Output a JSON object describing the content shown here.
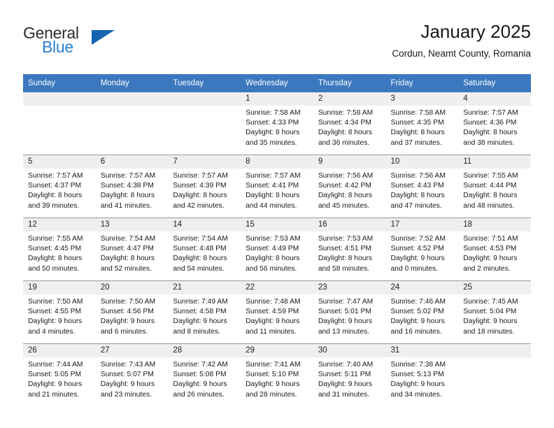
{
  "brand": {
    "line1": "General",
    "line2": "Blue",
    "accent_color": "#1565b0",
    "text_color": "#2a7fd4"
  },
  "header": {
    "title": "January 2025",
    "location": "Cordun, Neamt County, Romania"
  },
  "theme": {
    "header_bar": "#3b78bf",
    "daynum_bg": "#efefef",
    "grid_line": "#9a9a9a"
  },
  "weekdays": [
    {
      "label": "Sunday"
    },
    {
      "label": "Monday"
    },
    {
      "label": "Tuesday"
    },
    {
      "label": "Wednesday"
    },
    {
      "label": "Thursday"
    },
    {
      "label": "Friday"
    },
    {
      "label": "Saturday"
    }
  ],
  "weeks": [
    [
      {
        "day": "",
        "empty": true,
        "sunrise": "",
        "sunset": "",
        "daylight1": "",
        "daylight2": ""
      },
      {
        "day": "",
        "empty": true,
        "sunrise": "",
        "sunset": "",
        "daylight1": "",
        "daylight2": ""
      },
      {
        "day": "",
        "empty": true,
        "sunrise": "",
        "sunset": "",
        "daylight1": "",
        "daylight2": ""
      },
      {
        "day": "1",
        "empty": false,
        "sunrise": "Sunrise: 7:58 AM",
        "sunset": "Sunset: 4:33 PM",
        "daylight1": "Daylight: 8 hours",
        "daylight2": "and 35 minutes."
      },
      {
        "day": "2",
        "empty": false,
        "sunrise": "Sunrise: 7:58 AM",
        "sunset": "Sunset: 4:34 PM",
        "daylight1": "Daylight: 8 hours",
        "daylight2": "and 36 minutes."
      },
      {
        "day": "3",
        "empty": false,
        "sunrise": "Sunrise: 7:58 AM",
        "sunset": "Sunset: 4:35 PM",
        "daylight1": "Daylight: 8 hours",
        "daylight2": "and 37 minutes."
      },
      {
        "day": "4",
        "empty": false,
        "sunrise": "Sunrise: 7:57 AM",
        "sunset": "Sunset: 4:36 PM",
        "daylight1": "Daylight: 8 hours",
        "daylight2": "and 38 minutes."
      }
    ],
    [
      {
        "day": "5",
        "empty": false,
        "sunrise": "Sunrise: 7:57 AM",
        "sunset": "Sunset: 4:37 PM",
        "daylight1": "Daylight: 8 hours",
        "daylight2": "and 39 minutes."
      },
      {
        "day": "6",
        "empty": false,
        "sunrise": "Sunrise: 7:57 AM",
        "sunset": "Sunset: 4:38 PM",
        "daylight1": "Daylight: 8 hours",
        "daylight2": "and 41 minutes."
      },
      {
        "day": "7",
        "empty": false,
        "sunrise": "Sunrise: 7:57 AM",
        "sunset": "Sunset: 4:39 PM",
        "daylight1": "Daylight: 8 hours",
        "daylight2": "and 42 minutes."
      },
      {
        "day": "8",
        "empty": false,
        "sunrise": "Sunrise: 7:57 AM",
        "sunset": "Sunset: 4:41 PM",
        "daylight1": "Daylight: 8 hours",
        "daylight2": "and 44 minutes."
      },
      {
        "day": "9",
        "empty": false,
        "sunrise": "Sunrise: 7:56 AM",
        "sunset": "Sunset: 4:42 PM",
        "daylight1": "Daylight: 8 hours",
        "daylight2": "and 45 minutes."
      },
      {
        "day": "10",
        "empty": false,
        "sunrise": "Sunrise: 7:56 AM",
        "sunset": "Sunset: 4:43 PM",
        "daylight1": "Daylight: 8 hours",
        "daylight2": "and 47 minutes."
      },
      {
        "day": "11",
        "empty": false,
        "sunrise": "Sunrise: 7:55 AM",
        "sunset": "Sunset: 4:44 PM",
        "daylight1": "Daylight: 8 hours",
        "daylight2": "and 48 minutes."
      }
    ],
    [
      {
        "day": "12",
        "empty": false,
        "sunrise": "Sunrise: 7:55 AM",
        "sunset": "Sunset: 4:45 PM",
        "daylight1": "Daylight: 8 hours",
        "daylight2": "and 50 minutes."
      },
      {
        "day": "13",
        "empty": false,
        "sunrise": "Sunrise: 7:54 AM",
        "sunset": "Sunset: 4:47 PM",
        "daylight1": "Daylight: 8 hours",
        "daylight2": "and 52 minutes."
      },
      {
        "day": "14",
        "empty": false,
        "sunrise": "Sunrise: 7:54 AM",
        "sunset": "Sunset: 4:48 PM",
        "daylight1": "Daylight: 8 hours",
        "daylight2": "and 54 minutes."
      },
      {
        "day": "15",
        "empty": false,
        "sunrise": "Sunrise: 7:53 AM",
        "sunset": "Sunset: 4:49 PM",
        "daylight1": "Daylight: 8 hours",
        "daylight2": "and 56 minutes."
      },
      {
        "day": "16",
        "empty": false,
        "sunrise": "Sunrise: 7:53 AM",
        "sunset": "Sunset: 4:51 PM",
        "daylight1": "Daylight: 8 hours",
        "daylight2": "and 58 minutes."
      },
      {
        "day": "17",
        "empty": false,
        "sunrise": "Sunrise: 7:52 AM",
        "sunset": "Sunset: 4:52 PM",
        "daylight1": "Daylight: 9 hours",
        "daylight2": "and 0 minutes."
      },
      {
        "day": "18",
        "empty": false,
        "sunrise": "Sunrise: 7:51 AM",
        "sunset": "Sunset: 4:53 PM",
        "daylight1": "Daylight: 9 hours",
        "daylight2": "and 2 minutes."
      }
    ],
    [
      {
        "day": "19",
        "empty": false,
        "sunrise": "Sunrise: 7:50 AM",
        "sunset": "Sunset: 4:55 PM",
        "daylight1": "Daylight: 9 hours",
        "daylight2": "and 4 minutes."
      },
      {
        "day": "20",
        "empty": false,
        "sunrise": "Sunrise: 7:50 AM",
        "sunset": "Sunset: 4:56 PM",
        "daylight1": "Daylight: 9 hours",
        "daylight2": "and 6 minutes."
      },
      {
        "day": "21",
        "empty": false,
        "sunrise": "Sunrise: 7:49 AM",
        "sunset": "Sunset: 4:58 PM",
        "daylight1": "Daylight: 9 hours",
        "daylight2": "and 8 minutes."
      },
      {
        "day": "22",
        "empty": false,
        "sunrise": "Sunrise: 7:48 AM",
        "sunset": "Sunset: 4:59 PM",
        "daylight1": "Daylight: 9 hours",
        "daylight2": "and 11 minutes."
      },
      {
        "day": "23",
        "empty": false,
        "sunrise": "Sunrise: 7:47 AM",
        "sunset": "Sunset: 5:01 PM",
        "daylight1": "Daylight: 9 hours",
        "daylight2": "and 13 minutes."
      },
      {
        "day": "24",
        "empty": false,
        "sunrise": "Sunrise: 7:46 AM",
        "sunset": "Sunset: 5:02 PM",
        "daylight1": "Daylight: 9 hours",
        "daylight2": "and 16 minutes."
      },
      {
        "day": "25",
        "empty": false,
        "sunrise": "Sunrise: 7:45 AM",
        "sunset": "Sunset: 5:04 PM",
        "daylight1": "Daylight: 9 hours",
        "daylight2": "and 18 minutes."
      }
    ],
    [
      {
        "day": "26",
        "empty": false,
        "sunrise": "Sunrise: 7:44 AM",
        "sunset": "Sunset: 5:05 PM",
        "daylight1": "Daylight: 9 hours",
        "daylight2": "and 21 minutes."
      },
      {
        "day": "27",
        "empty": false,
        "sunrise": "Sunrise: 7:43 AM",
        "sunset": "Sunset: 5:07 PM",
        "daylight1": "Daylight: 9 hours",
        "daylight2": "and 23 minutes."
      },
      {
        "day": "28",
        "empty": false,
        "sunrise": "Sunrise: 7:42 AM",
        "sunset": "Sunset: 5:08 PM",
        "daylight1": "Daylight: 9 hours",
        "daylight2": "and 26 minutes."
      },
      {
        "day": "29",
        "empty": false,
        "sunrise": "Sunrise: 7:41 AM",
        "sunset": "Sunset: 5:10 PM",
        "daylight1": "Daylight: 9 hours",
        "daylight2": "and 28 minutes."
      },
      {
        "day": "30",
        "empty": false,
        "sunrise": "Sunrise: 7:40 AM",
        "sunset": "Sunset: 5:11 PM",
        "daylight1": "Daylight: 9 hours",
        "daylight2": "and 31 minutes."
      },
      {
        "day": "31",
        "empty": false,
        "sunrise": "Sunrise: 7:38 AM",
        "sunset": "Sunset: 5:13 PM",
        "daylight1": "Daylight: 9 hours",
        "daylight2": "and 34 minutes."
      },
      {
        "day": "",
        "empty": true,
        "sunrise": "",
        "sunset": "",
        "daylight1": "",
        "daylight2": ""
      }
    ]
  ]
}
